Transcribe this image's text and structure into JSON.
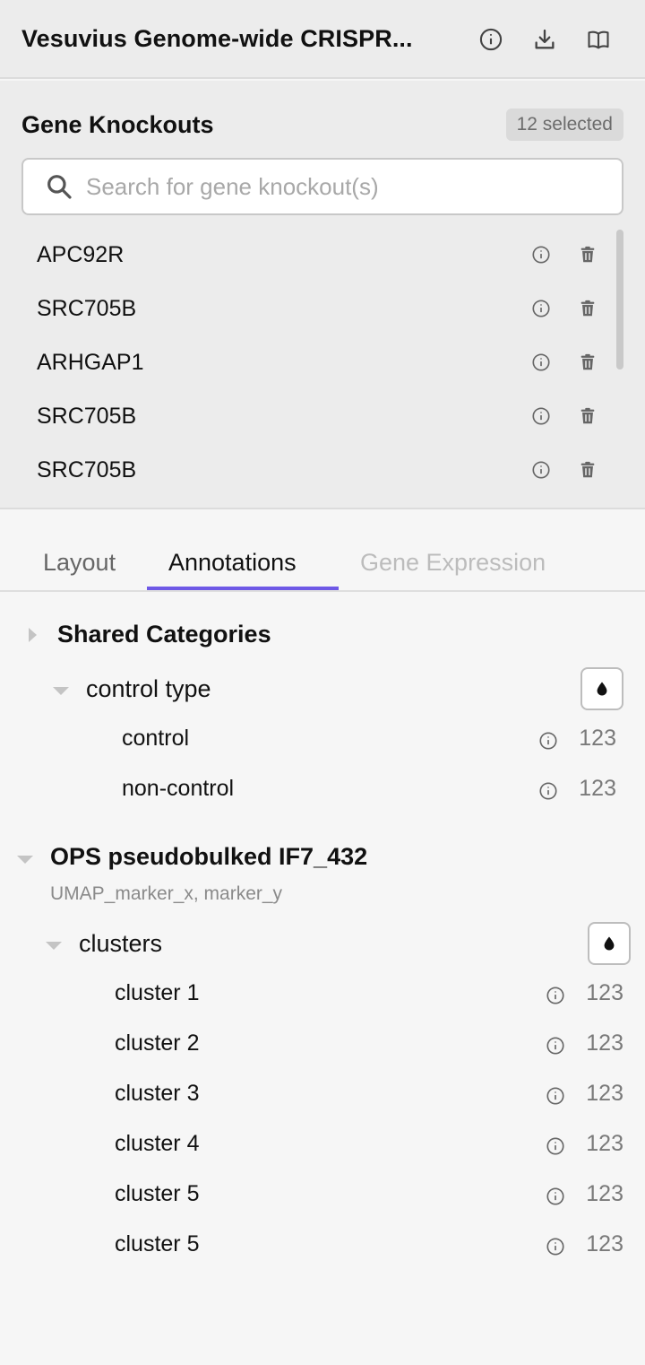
{
  "header": {
    "title": "Vesuvius Genome-wide CRISPR...",
    "icons": [
      "info-icon",
      "download-icon",
      "book-icon"
    ]
  },
  "knockouts": {
    "title": "Gene Knockouts",
    "badge": "12 selected",
    "search": {
      "placeholder": "Search for gene knockout(s)",
      "value": ""
    },
    "items": [
      {
        "label": "APC92R"
      },
      {
        "label": "SRC705B"
      },
      {
        "label": "ARHGAP1"
      },
      {
        "label": "SRC705B"
      },
      {
        "label": "SRC705B"
      }
    ]
  },
  "tabs": [
    {
      "label": "Layout",
      "state": "inactive"
    },
    {
      "label": "Annotations",
      "state": "active"
    },
    {
      "label": "Gene Expression",
      "state": "disabled"
    }
  ],
  "annotations": {
    "shared": {
      "title": "Shared Categories",
      "group": {
        "label": "control type",
        "items": [
          {
            "label": "control",
            "count": "123"
          },
          {
            "label": "non-control",
            "count": "123"
          }
        ]
      }
    },
    "ops": {
      "title": "OPS pseudobulked IF7_432",
      "subtitle": "UMAP_marker_x, marker_y",
      "group": {
        "label": "clusters",
        "items": [
          {
            "label": "cluster 1",
            "count": "123"
          },
          {
            "label": "cluster 2",
            "count": "123"
          },
          {
            "label": "cluster 3",
            "count": "123"
          },
          {
            "label": "cluster 4",
            "count": "123"
          },
          {
            "label": "cluster 5",
            "count": "123"
          },
          {
            "label": "cluster 5",
            "count": "123"
          }
        ]
      }
    }
  },
  "colors": {
    "accent": "#6e59e6",
    "panel_bg": "#ececec",
    "page_bg": "#f6f6f6"
  }
}
